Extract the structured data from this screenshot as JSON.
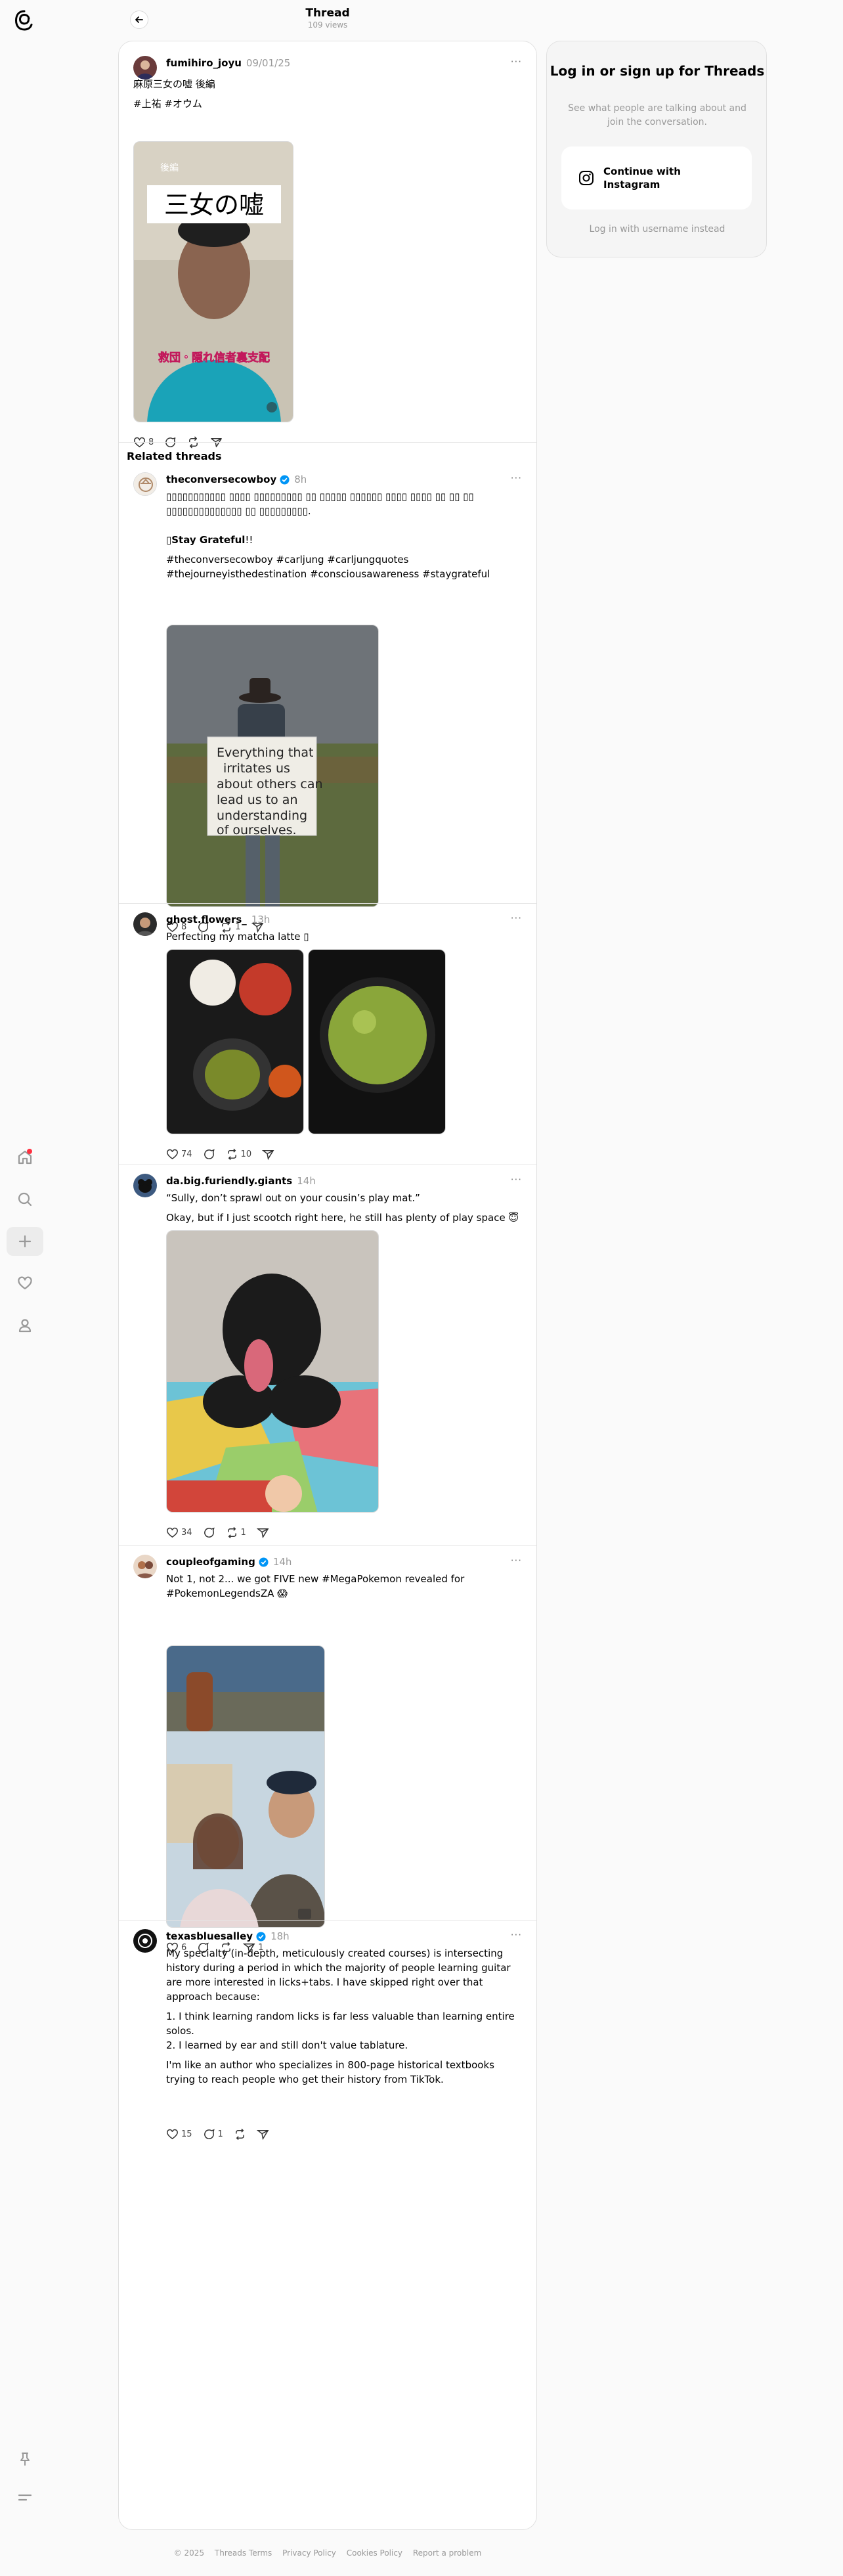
{
  "header": {
    "title": "Thread",
    "subtitle": "109 views",
    "back_icon": "arrow-left-icon"
  },
  "rail": {
    "logo_icon": "threads-logo-icon",
    "items": [
      "home-icon",
      "search-icon",
      "plus-icon",
      "heart-icon",
      "profile-icon"
    ],
    "bottom": [
      "pin-icon",
      "menu-icon"
    ],
    "notification_color": "#ff3040"
  },
  "main_post": {
    "username": "fumihiro_joyu",
    "time": "09/01/25",
    "line1": "麻原三女の嘘 後編",
    "line2": "#上祐 #オウム",
    "video_badge": "後編",
    "video_title": "三女の嘘",
    "video_caption": "救団・隠れ信者裏支配",
    "likes": "8",
    "more": "···"
  },
  "related": {
    "title": "Related threads",
    "posts": [
      {
        "username": "theconversecowboy",
        "time": "8h",
        "text_top": "▯▯▯▯▯▯▯▯▯▯▯ ▯▯▯▯ ▯▯▯▯▯▯▯▯▯ ▯▯ ▯▯▯▯▯ ▯▯▯▯▯▯ ▯▯▯▯ ▯▯▯▯ ▯▯ ▯▯ ▯▯ ▯▯▯▯▯▯▯▯▯▯▯▯▯▯ ▯▯ ▯▯▯▯▯▯▯▯▯.",
        "bold": "▯Stay Grateful",
        "bold_suffix": "!!",
        "tags": "#theconversecowboy #carljung #carljungquotes #thejourneyisthedestination #consciousawareness #staygrateful",
        "sign_text": "Everything that irritates us about others can lead us to an understanding of ourselves.",
        "likes": "8",
        "reposts": "1"
      },
      {
        "username": "ghost.flowers_",
        "time": "13h",
        "text": "Perfecting my matcha latte ▯",
        "likes": "74",
        "reposts": "10"
      },
      {
        "username": "da.big.furiendly.giants",
        "time": "14h",
        "text1": "“Sully, don’t sprawl out on your cousin’s play mat.”",
        "text2": "Okay, but if I just scootch right here, he still has plenty of play space 😇",
        "likes": "34",
        "reposts": "1"
      },
      {
        "username": "coupleofgaming",
        "time": "14h",
        "text": "Not 1, not 2... we got FIVE new #MegaPokemon revealed for #PokemonLegendsZA 😱",
        "likes": "6",
        "shares": "1"
      },
      {
        "username": "texasbluesalley",
        "time": "18h",
        "p1": "My specialty (in-depth, meticulously created courses) is intersecting history during a period in which the majority of people learning guitar are more interested in licks+tabs. I have skipped right over that approach because:",
        "p2": "1. I think learning random licks is far less valuable than learning entire solos.\n2. I learned by ear and still don't value tablature.",
        "p3": "I'm like an author who specializes in 800-page historical textbooks trying to reach people who get their history from TikTok.",
        "likes": "15",
        "replies": "1"
      }
    ]
  },
  "login": {
    "title": "Log in or sign up for Threads",
    "subtitle": "See what people are talking about and join the conversation.",
    "instagram_button": "Continue with Instagram",
    "alt": "Log in with username instead"
  },
  "footer": [
    "© 2025",
    "Threads Terms",
    "Privacy Policy",
    "Cookies Policy",
    "Report a problem"
  ],
  "colors": {
    "verified": "#0095f6",
    "muted": "#999999"
  }
}
